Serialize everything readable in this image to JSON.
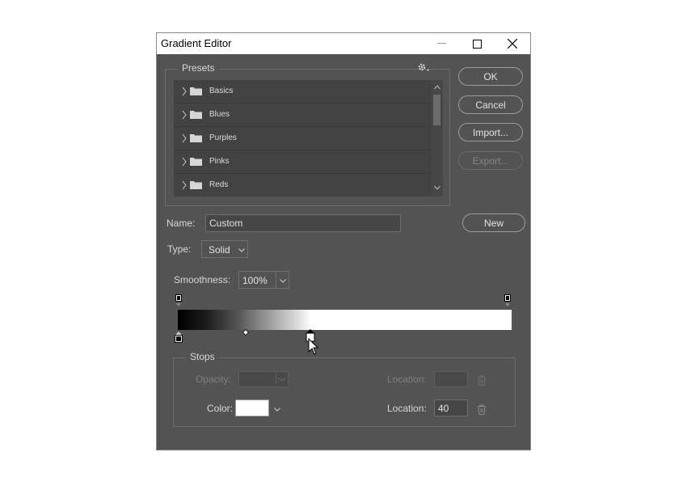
{
  "window": {
    "title": "Gradient Editor"
  },
  "presets": {
    "title": "Presets",
    "items": [
      {
        "label": "Basics"
      },
      {
        "label": "Blues"
      },
      {
        "label": "Purples"
      },
      {
        "label": "Pinks"
      },
      {
        "label": "Reds"
      }
    ]
  },
  "buttons": {
    "ok": "OK",
    "cancel": "Cancel",
    "import": "Import...",
    "export": "Export...",
    "new": "New"
  },
  "name": {
    "label": "Name:",
    "value": "Custom"
  },
  "type": {
    "label": "Type:",
    "value": "Solid"
  },
  "smoothness": {
    "label": "Smoothness:",
    "value": "100%"
  },
  "stops": {
    "title": "Stops",
    "opacity_label": "Opacity:",
    "opacity_value": "",
    "opacity_location_label": "Location:",
    "opacity_location_value": "",
    "color_label": "Color:",
    "color_swatch": "#ffffff",
    "color_location_label": "Location:",
    "color_location_value": "40"
  },
  "gradient": {
    "start_color": "#000000",
    "end_color": "#ffffff",
    "color_stop_location": 40,
    "midpoint_location": 20
  },
  "colors": {
    "dialog_bg": "#535353",
    "title_bar": "#ffffff",
    "list_bg": "#424242"
  }
}
